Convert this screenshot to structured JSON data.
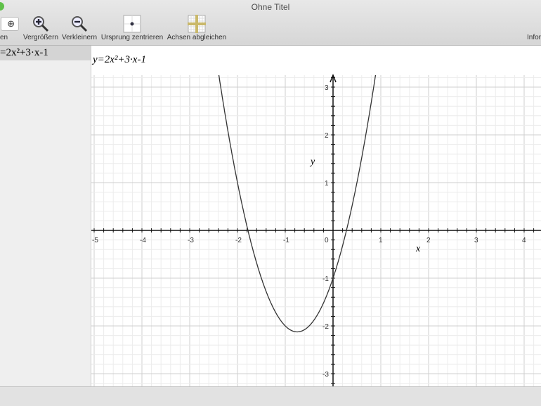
{
  "window": {
    "title": "Ohne Titel"
  },
  "toolbar": {
    "items": [
      {
        "label": "en",
        "icon": "zoom-in-small"
      },
      {
        "label": "Vergrößern",
        "icon": "zoom-in"
      },
      {
        "label": "Verkleinern",
        "icon": "zoom-out"
      },
      {
        "label": "Ursprung zentrieren",
        "icon": "center-origin"
      },
      {
        "label": "Achsen abgleichen",
        "icon": "align-axes"
      }
    ],
    "info_label": "Infor"
  },
  "sidebar": {
    "equation": "=2x²+3·x-1"
  },
  "graph": {
    "equation": "y=2x²+3·x-1"
  },
  "chart_data": {
    "type": "line",
    "function": "y=2x^2+3x-1",
    "xlabel": "x",
    "ylabel": "y",
    "xlim": [
      -5,
      4.4
    ],
    "ylim": [
      -3.2,
      3.2
    ],
    "x_ticks": [
      "-5",
      "-4",
      "-3",
      "-2",
      "-1",
      "0",
      "1",
      "2",
      "3",
      "4"
    ],
    "y_ticks": [
      "3",
      "2",
      "1",
      "-1",
      "-2",
      "-3"
    ],
    "grid": true
  }
}
